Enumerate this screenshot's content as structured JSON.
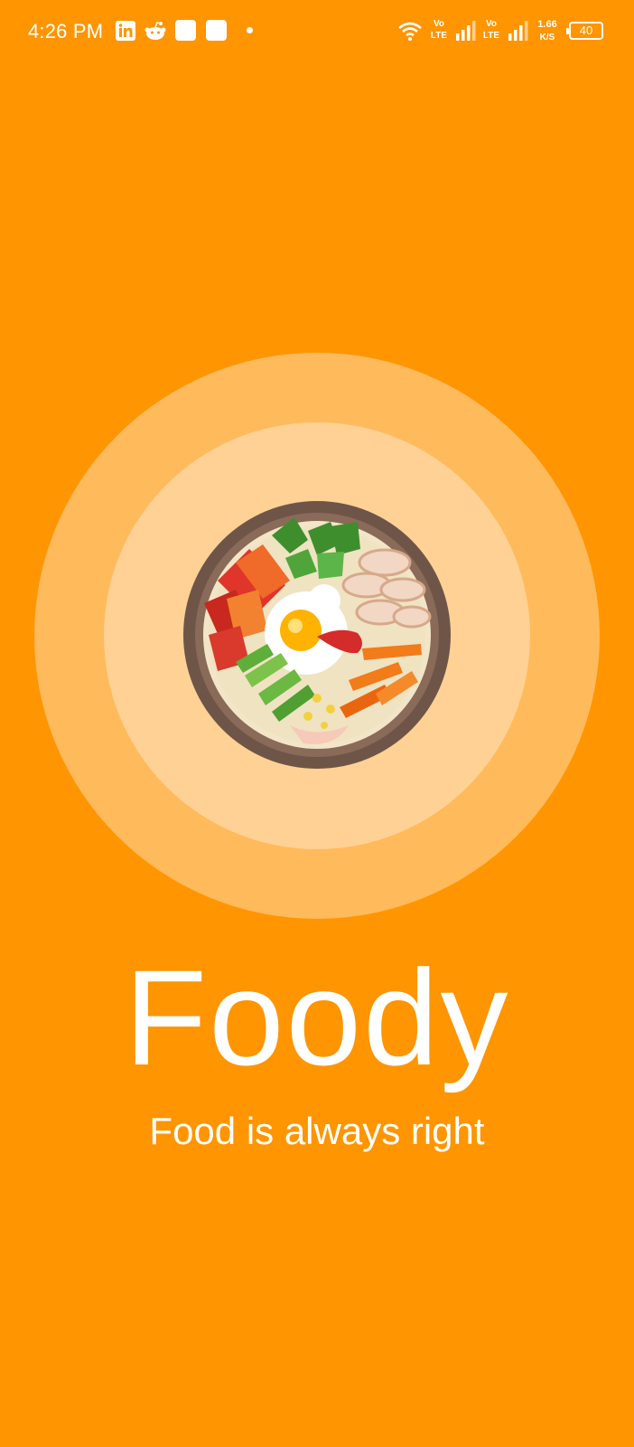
{
  "status_bar": {
    "time": "4:26 PM",
    "left_icons": [
      "linkedin-icon",
      "reddit-icon",
      "notification-square-icon",
      "notification-square-icon",
      "dot-icon"
    ],
    "network_1_label_top": "Vo",
    "network_1_label_bottom": "LTE",
    "network_2_label_top": "Vo",
    "network_2_label_bottom": "LTE",
    "speed_value": "1.66",
    "speed_unit": "K/S",
    "battery": "40"
  },
  "splash": {
    "title": "Foody",
    "tagline": "Food is always right",
    "icon": "bibimbap-bowl-icon"
  },
  "colors": {
    "background": "#FF9500",
    "outer_circle": "#FFBA5C",
    "inner_circle": "#FFD194",
    "text": "#FFFFFF"
  }
}
